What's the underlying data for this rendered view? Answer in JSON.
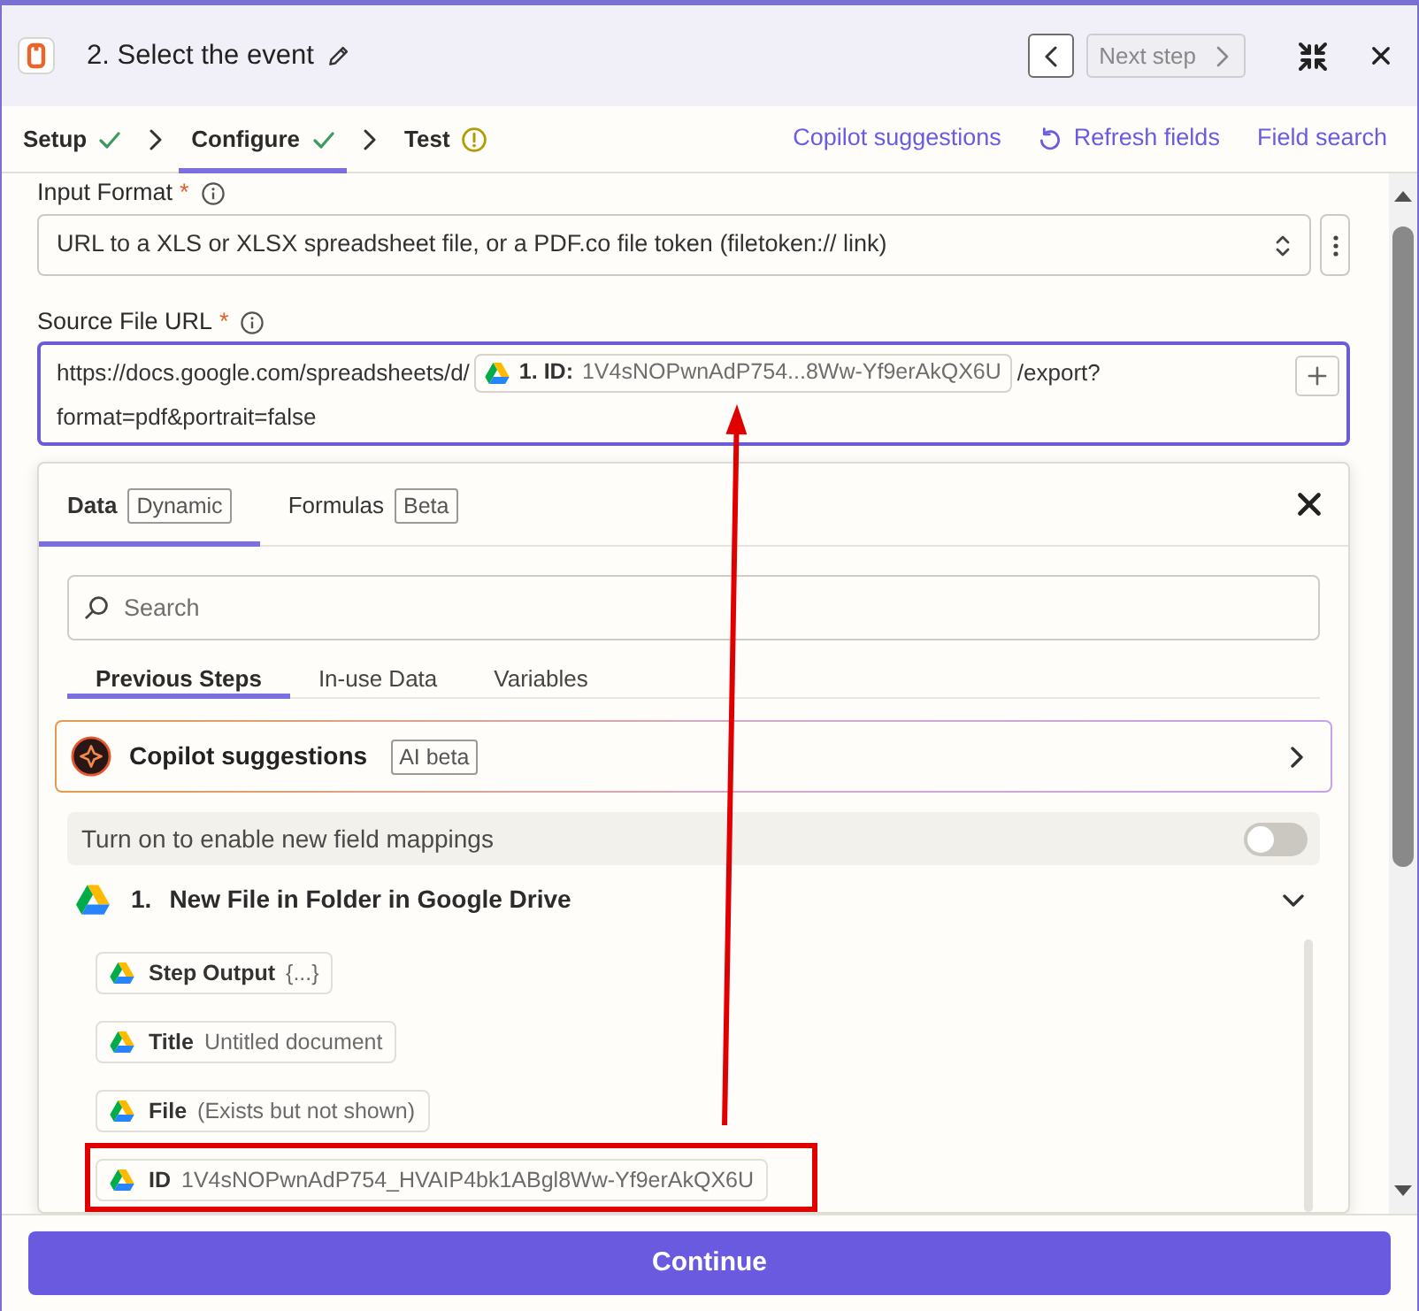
{
  "header": {
    "title": "2. Select the event",
    "prev_button": {
      "disabled": false
    },
    "next_button": {
      "label": "Next step",
      "disabled": true
    }
  },
  "tabs": [
    {
      "label": "Setup",
      "done": true,
      "needs_attention": false,
      "selected": false
    },
    {
      "label": "Configure",
      "done": true,
      "needs_attention": false,
      "selected": true
    },
    {
      "label": "Test",
      "done": false,
      "needs_attention": true,
      "selected": false
    }
  ],
  "links": [
    {
      "label": "Copilot suggestions",
      "kind": "plain"
    },
    {
      "label": "Refresh fields",
      "kind": "refresh"
    },
    {
      "label": "Field search",
      "kind": "plain"
    }
  ],
  "fields": [
    {
      "kind": "select",
      "label": "Input Format",
      "required_mark": "*",
      "focused": false,
      "value": "URL to a XLS or XLSX spreadsheet file, or a PDF.co file token (filetoken:// link)"
    },
    {
      "kind": "mapped",
      "label": "Source File URL",
      "required_mark": "*",
      "focused": true,
      "lines": [
        [
          {
            "kind": "text",
            "text": "https://docs.google.com/spreadsheets/d/"
          },
          {
            "kind": "token",
            "label": "1. ID:",
            "value": "1V4sNOPwnAdP754...8Ww-Yf9erAkQX6U"
          },
          {
            "kind": "text",
            "text": "/export?"
          }
        ],
        [
          {
            "kind": "text",
            "text": "format=pdf&portrait=false"
          }
        ]
      ]
    }
  ],
  "panel": {
    "tabs": [
      {
        "label": "Data",
        "badge": "Dynamic",
        "selected": true
      },
      {
        "label": "Formulas",
        "badge": "Beta",
        "selected": false
      }
    ],
    "search": {
      "placeholder": "Search"
    },
    "subtabs": [
      {
        "label": "Previous Steps",
        "selected": true
      },
      {
        "label": "In-use Data",
        "selected": false
      },
      {
        "label": "Variables",
        "selected": false
      }
    ],
    "copilot": {
      "title": "Copilot suggestions",
      "badge": "AI beta"
    },
    "mapping_toggle": {
      "label": "Turn on to enable new field mappings",
      "on": false
    },
    "steps": [
      {
        "number": "1.",
        "title": "New File in Folder in Google Drive",
        "expanded": true,
        "fields": [
          {
            "label": "Step Output",
            "value": "{...}",
            "highlighted": false
          },
          {
            "label": "Title",
            "value": "Untitled document",
            "highlighted": false
          },
          {
            "label": "File",
            "value": "(Exists but not shown)",
            "highlighted": false
          },
          {
            "label": "ID",
            "value": "1V4sNOPwnAdP754_HVAIP4bk1ABgl8Ww-Yf9erAkQX6U",
            "highlighted": true
          }
        ]
      }
    ]
  },
  "annotations": [
    {
      "kind": "arrow"
    }
  ],
  "footer": {
    "button": "Continue"
  }
}
